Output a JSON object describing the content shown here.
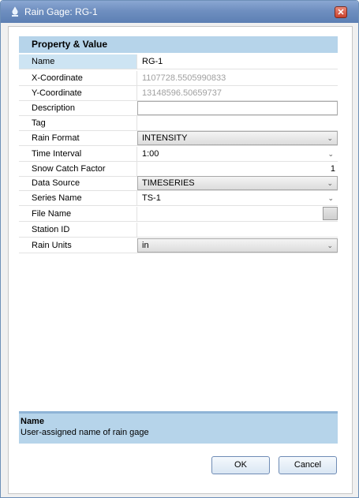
{
  "window": {
    "title": "Rain Gage: RG-1",
    "close_glyph": "✕",
    "icon": "rain-gage-icon"
  },
  "grid": {
    "header": "Property  &  Value",
    "rows": [
      {
        "label": "Name",
        "value": "RG-1",
        "kind": "text"
      },
      {
        "label": "X-Coordinate",
        "value": "1107728.5505990833",
        "kind": "readonly"
      },
      {
        "label": "Y-Coordinate",
        "value": "13148596.50659737",
        "kind": "readonly"
      },
      {
        "label": "Description",
        "value": "",
        "kind": "textbox"
      },
      {
        "label": "Tag",
        "value": "",
        "kind": "text"
      },
      {
        "label": "Rain Format",
        "value": "INTENSITY",
        "kind": "combo"
      },
      {
        "label": "Time Interval",
        "value": "1:00",
        "kind": "dropdown"
      },
      {
        "label": "Snow Catch Factor",
        "value": "1",
        "kind": "number"
      },
      {
        "label": "Data Source",
        "value": "TIMESERIES",
        "kind": "combo"
      },
      {
        "label": "Series Name",
        "value": "TS-1",
        "kind": "dropdown"
      },
      {
        "label": "File Name",
        "value": "",
        "kind": "browse"
      },
      {
        "label": "Station ID",
        "value": "",
        "kind": "text"
      },
      {
        "label": "Rain Units",
        "value": "in",
        "kind": "combo"
      }
    ]
  },
  "description_panel": {
    "title": "Name",
    "text": "User-assigned name of rain gage"
  },
  "buttons": {
    "ok": "OK",
    "cancel": "Cancel"
  },
  "colors": {
    "header_bg": "#b6d4ea",
    "selected_label_bg": "#cde4f3",
    "titlebar": "#6f8fc0"
  }
}
